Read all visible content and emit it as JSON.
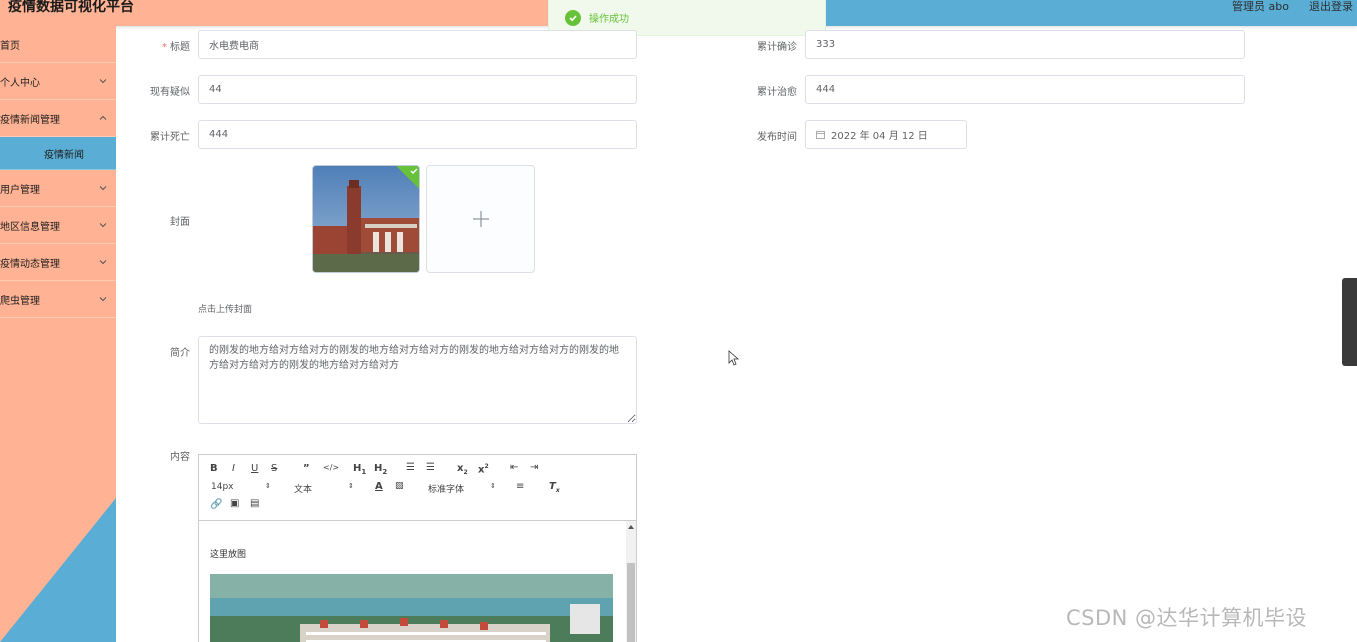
{
  "header": {
    "title": "疫情数据可视化平台",
    "admin": "管理员 abo",
    "logout": "退出登录"
  },
  "toast": {
    "message": "操作成功"
  },
  "sidebar": {
    "items": [
      {
        "label": "首页"
      },
      {
        "label": "个人中心"
      },
      {
        "label": "疫情新闻管理"
      },
      {
        "label": "疫情新闻"
      },
      {
        "label": "用户管理"
      },
      {
        "label": "地区信息管理"
      },
      {
        "label": "疫情动态管理"
      },
      {
        "label": "爬虫管理"
      }
    ]
  },
  "form": {
    "title_label": "标题",
    "title_value": "水电费电商",
    "confirmed_label": "累计确诊",
    "confirmed_value": "333",
    "suspected_label": "现有疑似",
    "suspected_value": "44",
    "cured_label": "累计治愈",
    "cured_value": "444",
    "deaths_label": "累计死亡",
    "deaths_value": "444",
    "publish_label": "发布时间",
    "publish_value": "2022 年 04 月 12 日",
    "cover_label": "封面",
    "cover_tip": "点击上传封面",
    "intro_label": "简介",
    "intro_value": "的刚发的地方给对方给对方的刚发的地方给对方给对方的刚发的地方给对方给对方的刚发的地方给对方给对方的刚发的地方给对方给对方",
    "content_label": "内容"
  },
  "editor": {
    "font_size": "14px",
    "text_style": "文本",
    "font_family": "标准字体",
    "body_text": "这里放图"
  },
  "watermark": "CSDN @达华计算机毕设",
  "colors": {
    "sidebar": "#ffb394",
    "accent": "#5aaed6",
    "success": "#67c23a"
  }
}
